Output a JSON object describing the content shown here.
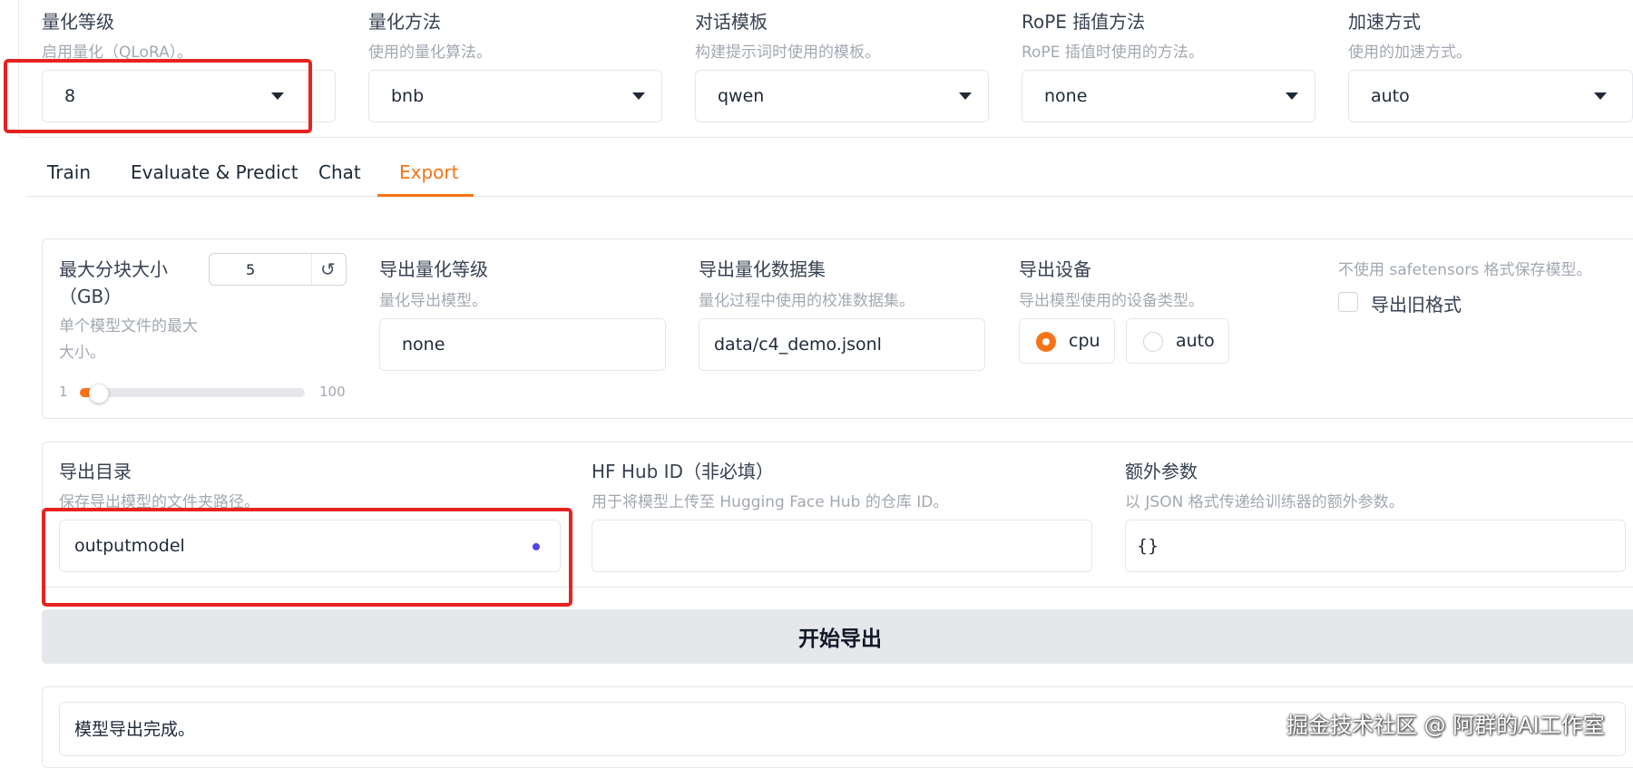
{
  "top_row": {
    "quant_level": {
      "label": "量化等级",
      "info": "启用量化（QLoRA）。",
      "value": "8"
    },
    "quant_method": {
      "label": "量化方法",
      "info": "使用的量化算法。",
      "value": "bnb"
    },
    "template": {
      "label": "对话模板",
      "info": "构建提示词时使用的模板。",
      "value": "qwen"
    },
    "rope": {
      "label": "RoPE 插值方法",
      "info": "RoPE 插值时使用的方法。",
      "value": "none"
    },
    "accel": {
      "label": "加速方式",
      "info": "使用的加速方式。",
      "value": "auto"
    }
  },
  "tabs": [
    {
      "label": "Train"
    },
    {
      "label": "Evaluate & Predict"
    },
    {
      "label": "Chat"
    },
    {
      "label": "Export",
      "active": true
    }
  ],
  "export": {
    "shard": {
      "label_line1": "最大分块大小",
      "label_line2": "（GB）",
      "info_line1": "单个模型文件的最大",
      "info_line2": "大小。",
      "value": "5",
      "min": "1",
      "max": "100",
      "slider_fraction": 0.04
    },
    "quant_bit": {
      "label": "导出量化等级",
      "info": "量化导出模型。",
      "value": "none"
    },
    "quant_dataset": {
      "label": "导出量化数据集",
      "info": "量化过程中使用的校准数据集。",
      "value": "data/c4_demo.jsonl"
    },
    "device": {
      "label": "导出设备",
      "info": "导出模型使用的设备类型。",
      "options": [
        "cpu",
        "auto"
      ],
      "selected": "cpu"
    },
    "legacy": {
      "info": "不使用 safetensors 格式保存模型。",
      "label": "导出旧格式",
      "checked": false
    },
    "dir": {
      "label": "导出目录",
      "info": "保存导出模型的文件夹路径。",
      "value": "outputmodel"
    },
    "hub": {
      "label": "HF Hub ID（非必填）",
      "info": "用于将模型上传至 Hugging Face Hub 的仓库 ID。",
      "value": ""
    },
    "extra": {
      "label": "额外参数",
      "info": "以 JSON 格式传递给训练器的额外参数。",
      "value": "{}"
    },
    "start_button": "开始导出",
    "output": "模型导出完成。"
  },
  "watermark": "掘金技术社区 @ 阿群的AI工作室",
  "colors": {
    "accent": "#f97316",
    "highlight": "#e8231f",
    "panel_border": "#e5e7eb",
    "button_bg": "#e5e7eb"
  }
}
